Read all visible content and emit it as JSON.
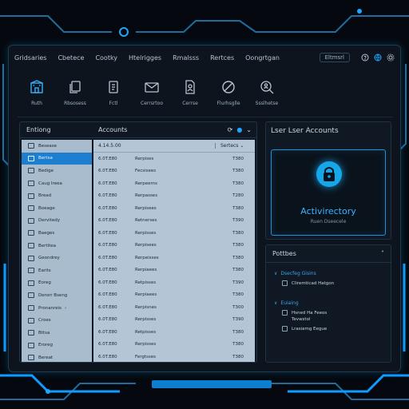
{
  "menu": {
    "items": [
      "Gridsaries",
      "Cbetece",
      "Cootky",
      "Htelrigges",
      "Rmalsss",
      "Rertces",
      "Oongrtgan"
    ],
    "user_chip": "Eltmsrl",
    "icons": [
      "help-icon",
      "globe-icon",
      "settings-icon"
    ]
  },
  "toolbar": {
    "tools": [
      {
        "label": "Ruth",
        "icon": "building-icon",
        "active": true
      },
      {
        "label": "Rbsosess",
        "icon": "copy-icon",
        "active": false
      },
      {
        "label": "Fctl",
        "icon": "document-icon",
        "active": false
      },
      {
        "label": "Cerrsrtoo",
        "icon": "mail-icon",
        "active": false
      },
      {
        "label": "Cerrse",
        "icon": "file-user-icon",
        "active": false
      },
      {
        "label": "Flurhsglle",
        "icon": "block-icon",
        "active": false
      },
      {
        "label": "Ssslhetse",
        "icon": "search-user-icon",
        "active": false
      }
    ]
  },
  "browser": {
    "tree_header": "Entiong",
    "grid_header": "Accounts",
    "header_icons": [
      "refresh-icon",
      "globe-icon",
      "chevron-down-icon"
    ],
    "tree": [
      {
        "label": "Besease",
        "selected": false
      },
      {
        "label": "Bertsa",
        "selected": true
      },
      {
        "label": "Bedige",
        "selected": false
      },
      {
        "label": "Caug Ireea",
        "selected": false
      },
      {
        "label": "Bread",
        "selected": false
      },
      {
        "label": "Boeage",
        "selected": false
      },
      {
        "label": "Dervitedy",
        "selected": false
      },
      {
        "label": "Baeges",
        "selected": false
      },
      {
        "label": "Bertitea",
        "selected": false
      },
      {
        "label": "Geondrey",
        "selected": false
      },
      {
        "label": "Earits",
        "selected": false
      },
      {
        "label": "Eoreg",
        "selected": false
      },
      {
        "label": "Derorr Bseng",
        "selected": false
      },
      {
        "label": "Pronanreis",
        "selected": false,
        "chevron": "›"
      },
      {
        "label": "Croes",
        "selected": false
      },
      {
        "label": "Bttsa",
        "selected": false
      },
      {
        "label": "Eroreg",
        "selected": false
      },
      {
        "label": "Bereat",
        "selected": false
      }
    ],
    "grid_columns": [
      "4.14.5.00",
      "",
      "Sertecs"
    ],
    "grid_rows": [
      {
        "date": "6.0T.E80",
        "name": "Rerpises",
        "code": "T380"
      },
      {
        "date": "6.0T.E80",
        "name": "Fecsisees",
        "code": "T380"
      },
      {
        "date": "6.0T.E80",
        "name": "Rerpeerns",
        "code": "T380"
      },
      {
        "date": "6.0T.E80",
        "name": "Rerpasses",
        "code": "T280"
      },
      {
        "date": "6.0T.E80",
        "name": "Rerpisees",
        "code": "T380"
      },
      {
        "date": "6.0T.E80",
        "name": "Retnerses",
        "code": "T390"
      },
      {
        "date": "6.0T.E80",
        "name": "Rerpisses",
        "code": "T380"
      },
      {
        "date": "6.0T.E80",
        "name": "Rerpisees",
        "code": "T380"
      },
      {
        "date": "6.0T.E80",
        "name": "Rerpeisses",
        "code": "T380"
      },
      {
        "date": "6.0T.E80",
        "name": "Rerpiaees",
        "code": "T380"
      },
      {
        "date": "6.0T.E80",
        "name": "Retpisses",
        "code": "T390"
      },
      {
        "date": "6.0T.E80",
        "name": "Rerpiaees",
        "code": "T380"
      },
      {
        "date": "6.0T.E80",
        "name": "Rerpisnes",
        "code": "T300"
      },
      {
        "date": "6.0T.E80",
        "name": "Rerpisses",
        "code": "T390"
      },
      {
        "date": "6.0T.E80",
        "name": "Retpisses",
        "code": "T380"
      },
      {
        "date": "6.0T.E80",
        "name": "Rerpisses",
        "code": "T380"
      },
      {
        "date": "6.0T.E80",
        "name": "Fergtsses",
        "code": "T380"
      }
    ]
  },
  "accounts_panel": {
    "title": "Lser Lser Accounts",
    "card_title": "Activirectory",
    "card_subtitle": "Ruen Dseecele",
    "lock_icon": "lock-icon",
    "accent": "#1ea6ff"
  },
  "properties": {
    "title": "Pottbes",
    "sections": [
      {
        "title": "Dsecfeg Gisins",
        "items": [
          "Cliremticad Hatgon"
        ]
      },
      {
        "title": "Euiaing",
        "items": [
          "Hsned Ha Feeos",
          "Tevwstol",
          "Lrasiamg Eegue"
        ]
      }
    ]
  }
}
